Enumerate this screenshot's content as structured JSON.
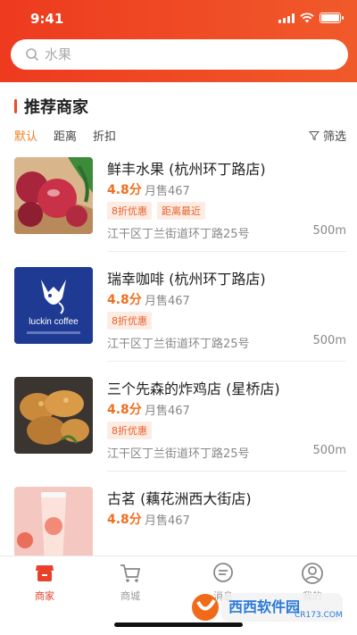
{
  "status_bar": {
    "time": "9:41"
  },
  "search": {
    "placeholder": "水果",
    "icon": "search-icon"
  },
  "section": {
    "title": "推荐商家"
  },
  "filters": {
    "items": [
      "默认",
      "距离",
      "折扣"
    ],
    "active": "默认",
    "filter_label": "筛选"
  },
  "merchants": [
    {
      "name": "鲜丰水果 (杭州环丁路店)",
      "rating": "4.8分",
      "sales": "月售467",
      "tags": [
        "8折优惠",
        "距离最近"
      ],
      "address": "江干区丁兰街道环丁路25号",
      "distance": "500m"
    },
    {
      "name": "瑞幸咖啡 (杭州环丁路店)",
      "rating": "4.8分",
      "sales": "月售467",
      "tags": [
        "8折优惠"
      ],
      "address": "江干区丁兰街道环丁路25号",
      "distance": "500m",
      "logo_text": "luckin coffee"
    },
    {
      "name": "三个先森的炸鸡店 (星桥店)",
      "rating": "4.8分",
      "sales": "月售467",
      "tags": [
        "8折优惠"
      ],
      "address": "江干区丁兰街道环丁路25号",
      "distance": "500m"
    },
    {
      "name": "古茗 (藕花洲西大街店)",
      "rating": "4.8分",
      "sales": "月售467",
      "tags": [],
      "address": "",
      "distance": ""
    }
  ],
  "tabbar": {
    "items": [
      {
        "label": "商家",
        "icon": "store-icon",
        "active": true
      },
      {
        "label": "商城",
        "icon": "cart-icon",
        "active": false
      },
      {
        "label": "消息",
        "icon": "message-icon",
        "active": false
      },
      {
        "label": "我的",
        "icon": "user-icon",
        "active": false
      }
    ]
  },
  "watermark": {
    "brand": "西西软件园",
    "url": "CR173.COM"
  },
  "colors": {
    "header": "#ee3a1f",
    "accent": "#f07020",
    "tag_bg": "#fdece3",
    "active_tab": "#e9402a"
  }
}
